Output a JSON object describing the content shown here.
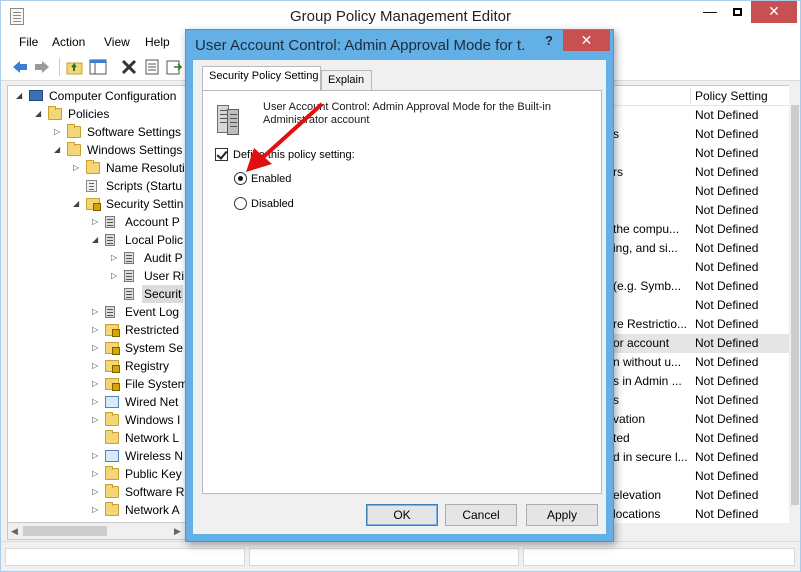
{
  "window": {
    "title": "Group Policy Management Editor",
    "buttons": {
      "minimize": "—",
      "close": "✕"
    }
  },
  "menu": [
    "File",
    "Action",
    "View",
    "Help"
  ],
  "toolbar_icons": [
    "back-icon",
    "forward-icon",
    "up-folder-icon",
    "show-hide-tree-icon",
    "delete-icon",
    "properties-icon",
    "export-icon",
    "help-icon",
    "console-icon"
  ],
  "tree": [
    {
      "label": "Computer Configuration",
      "icon": "comp",
      "expander": "◢"
    },
    {
      "label": "Policies",
      "icon": "folder",
      "expander": "◢"
    },
    {
      "label": "Software Settings",
      "icon": "folder",
      "expander": "▷"
    },
    {
      "label": "Windows Settings",
      "icon": "folder",
      "expander": "◢"
    },
    {
      "label": "Name Resoluti",
      "icon": "folder",
      "expander": "▷"
    },
    {
      "label": "Scripts (Startu",
      "icon": "doc",
      "expander": ""
    },
    {
      "label": "Security Settin",
      "icon": "lock",
      "expander": "◢"
    },
    {
      "label": "Account P",
      "icon": "server",
      "expander": "▷"
    },
    {
      "label": "Local Polic",
      "icon": "server",
      "expander": "◢"
    },
    {
      "label": "Audit P",
      "icon": "server",
      "expander": "▷"
    },
    {
      "label": "User Ri",
      "icon": "server",
      "expander": "▷"
    },
    {
      "label": "Securit",
      "icon": "server",
      "expander": ""
    },
    {
      "label": "Event Log",
      "icon": "server",
      "expander": "▷"
    },
    {
      "label": "Restricted",
      "icon": "lock",
      "expander": "▷"
    },
    {
      "label": "System Se",
      "icon": "lock",
      "expander": "▷"
    },
    {
      "label": "Registry",
      "icon": "lock",
      "expander": "▷"
    },
    {
      "label": "File System",
      "icon": "lock",
      "expander": "▷"
    },
    {
      "label": "Wired Net",
      "icon": "net",
      "expander": "▷"
    },
    {
      "label": "Windows I",
      "icon": "folder",
      "expander": "▷"
    },
    {
      "label": "Network L",
      "icon": "folder",
      "expander": ""
    },
    {
      "label": "Wireless N",
      "icon": "net",
      "expander": "▷"
    },
    {
      "label": "Public Key",
      "icon": "folder",
      "expander": "▷"
    },
    {
      "label": "Software R",
      "icon": "folder",
      "expander": "▷"
    },
    {
      "label": "Network A",
      "icon": "folder",
      "expander": "▷"
    }
  ],
  "list": {
    "header": "Policy Setting",
    "rows": [
      {
        "policy": "",
        "setting": "Not Defined"
      },
      {
        "policy": "s",
        "setting": "Not Defined"
      },
      {
        "policy": "",
        "setting": "Not Defined"
      },
      {
        "policy": "rs",
        "setting": "Not Defined"
      },
      {
        "policy": "",
        "setting": "Not Defined"
      },
      {
        "policy": "",
        "setting": "Not Defined"
      },
      {
        "policy": "the compu...",
        "setting": "Not Defined"
      },
      {
        "policy": "ing, and si...",
        "setting": "Not Defined"
      },
      {
        "policy": "",
        "setting": "Not Defined"
      },
      {
        "policy": "(e.g. Symb...",
        "setting": "Not Defined"
      },
      {
        "policy": "",
        "setting": "Not Defined"
      },
      {
        "policy": "re Restrictio...",
        "setting": "Not Defined"
      },
      {
        "policy": "or account",
        "setting": "Not Defined"
      },
      {
        "policy": "n without u...",
        "setting": "Not Defined"
      },
      {
        "policy": "s in Admin ...",
        "setting": "Not Defined"
      },
      {
        "policy": "s",
        "setting": "Not Defined"
      },
      {
        "policy": "vation",
        "setting": "Not Defined"
      },
      {
        "policy": "ted",
        "setting": "Not Defined"
      },
      {
        "policy": "d in secure l...",
        "setting": "Not Defined"
      },
      {
        "policy": "",
        "setting": "Not Defined"
      },
      {
        "policy": "elevation",
        "setting": "Not Defined"
      },
      {
        "policy": "locations",
        "setting": "Not Defined"
      }
    ]
  },
  "dialog": {
    "title": "User Account Control: Admin Approval Mode for t...",
    "help": "?",
    "close": "✕",
    "tabs": [
      "Security Policy Setting",
      "Explain"
    ],
    "policy_description": "User Account Control: Admin Approval Mode for the Built-in Administrator account",
    "define_label": "Define this policy setting:",
    "define_checked": true,
    "options": [
      {
        "label": "Enabled",
        "selected": true
      },
      {
        "label": "Disabled",
        "selected": false
      }
    ],
    "buttons": {
      "ok": "OK",
      "cancel": "Cancel",
      "apply": "Apply"
    }
  },
  "colors": {
    "dialog_frame": "#63b0e6",
    "close_button": "#c75050",
    "annotation_arrow": "#e01010"
  }
}
